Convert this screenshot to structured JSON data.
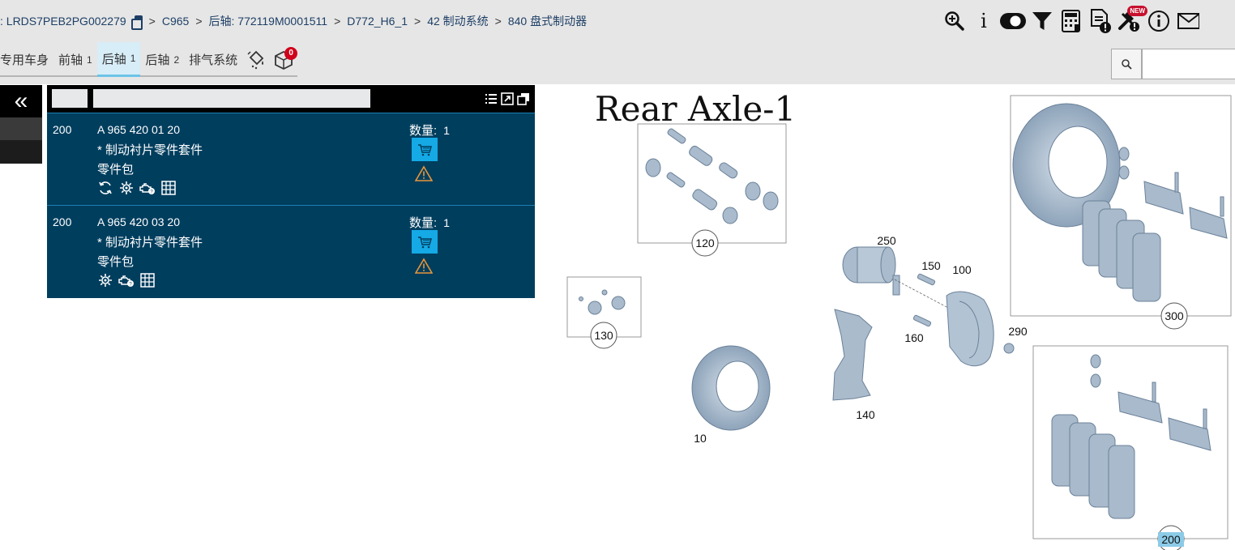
{
  "breadcrumb": {
    "vin": ": LRDS7PEB2PG002279",
    "items": [
      "C965",
      "后轴: 772119M0001511",
      "D772_H6_1",
      "42 制动系统",
      "840 盘式制动器"
    ],
    "separator": ">"
  },
  "toolbar": {
    "icons": [
      "zoom-in-icon",
      "info-icon",
      "toggle-icon",
      "filter-icon",
      "calculator-icon",
      "document-alert-icon",
      "tools-icon",
      "info-circle-icon",
      "mail-icon"
    ],
    "new_badge": "NEW"
  },
  "tabs": [
    {
      "label": "专用车身",
      "num": ""
    },
    {
      "label": "前轴",
      "num": "1"
    },
    {
      "label": "后轴",
      "num": "1"
    },
    {
      "label": "后轴",
      "num": "2"
    },
    {
      "label": "排气系统",
      "num": ""
    }
  ],
  "cart_badge": "0",
  "diagram_title": "Rear Axle-1",
  "search": {
    "placeholder": ""
  },
  "collapse_label": "«",
  "parts": [
    {
      "pos": "200",
      "part_number": "A 965 420 01 20",
      "description": "* 制动衬片零件套件",
      "note": "零件包",
      "qty_label": "数量:",
      "qty": "1"
    },
    {
      "pos": "200",
      "part_number": "A 965 420 03 20",
      "description": "* 制动衬片零件套件",
      "note": "零件包",
      "qty_label": "数量:",
      "qty": "1"
    }
  ],
  "callouts": [
    "120",
    "130",
    "250",
    "150",
    "100",
    "160",
    "290",
    "140",
    "10",
    "300",
    "200"
  ],
  "colors": {
    "panel": "#003e5e",
    "accent": "#15a9e6",
    "highlight": "#8ccbe8",
    "part": "#9fb3c8"
  }
}
